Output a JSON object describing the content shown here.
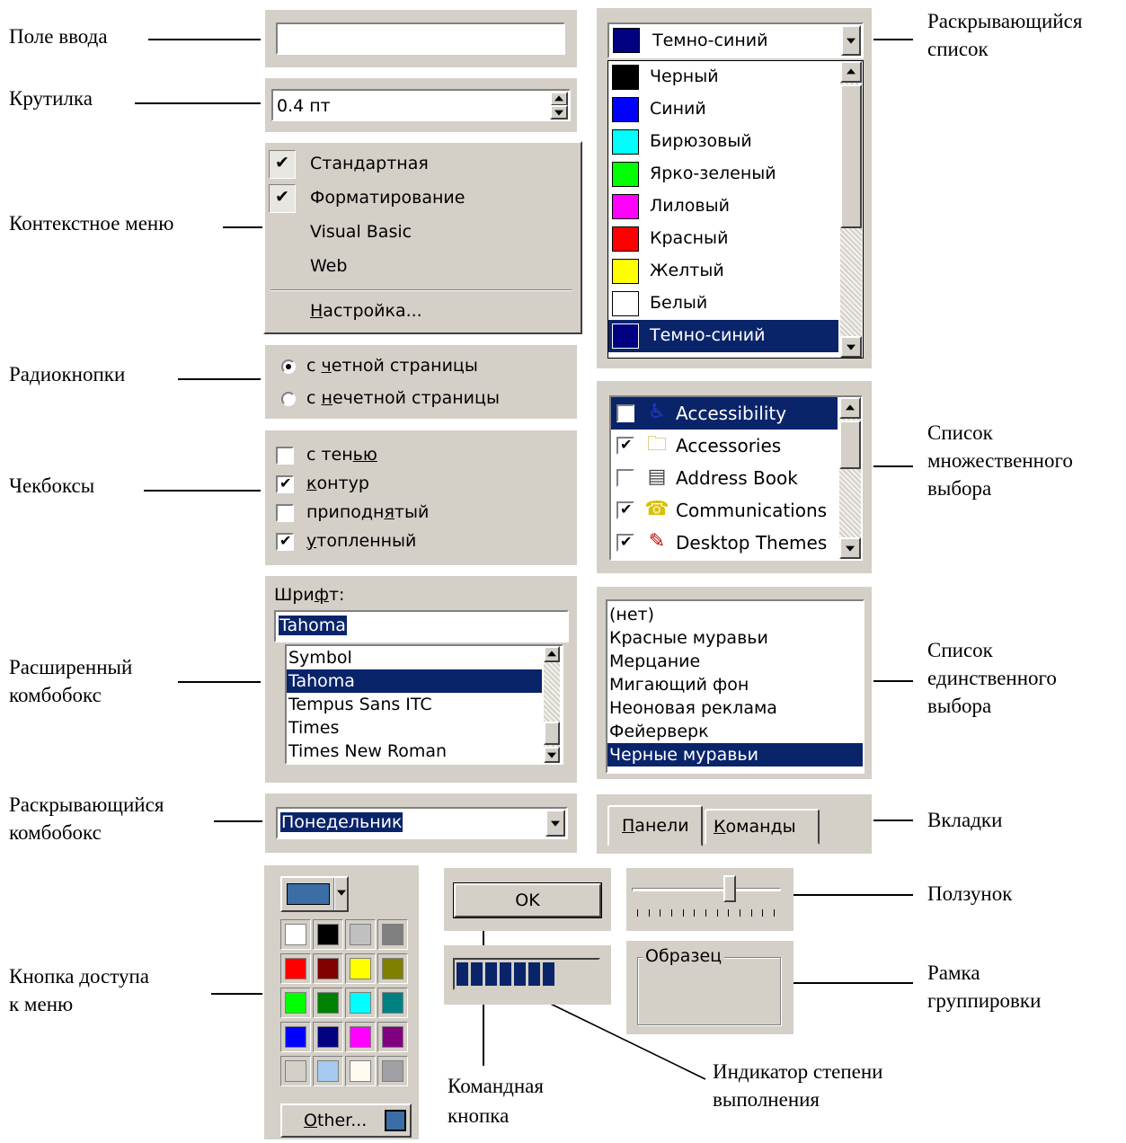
{
  "labels": {
    "input_field": "Поле ввода",
    "spinner": "Крутилка",
    "context_menu": "Контекстное меню",
    "radio_buttons": "Радиокнопки",
    "checkboxes": "Чекбоксы",
    "extended_combobox_1": "Расширенный",
    "extended_combobox_2": "комбобокс",
    "dropdown_combobox_1": "Раскрывающийся",
    "dropdown_combobox_2": "комбобокс",
    "menu_button_1": "Кнопка доступа",
    "menu_button_2": "к меню",
    "dropdown_list_1": "Раскрывающийся",
    "dropdown_list_2": "список",
    "multiselect_1": "Список",
    "multiselect_2": "множественного",
    "multiselect_3": "выбора",
    "singleselect_1": "Список",
    "singleselect_2": "единственного",
    "singleselect_3": "выбора",
    "tabs": "Вкладки",
    "slider": "Ползунок",
    "groupbox_1": "Рамка",
    "groupbox_2": "группировки",
    "command_button_1": "Командная",
    "command_button_2": "кнопка",
    "progress_1": "Индикатор степени",
    "progress_2": "выполнения"
  },
  "text_input": {
    "value": ""
  },
  "spinner": {
    "value": "0.4 пт"
  },
  "context_menu": {
    "items": [
      {
        "label": "Стандартная",
        "checked": true
      },
      {
        "label": "Форматирование",
        "checked": true
      },
      {
        "label": "Visual Basic",
        "checked": false
      },
      {
        "label": "Web",
        "checked": false
      }
    ],
    "customize_label": "Настройка..."
  },
  "radios": {
    "options": [
      {
        "label": "с четной страницы",
        "selected": true
      },
      {
        "label": "с нечетной страницы",
        "selected": false
      }
    ]
  },
  "checkboxes": {
    "items": [
      {
        "label": "с тенью",
        "checked": false
      },
      {
        "label": "контур",
        "checked": true
      },
      {
        "label": "приподнятый",
        "checked": false
      },
      {
        "label": "утопленный",
        "checked": true
      }
    ]
  },
  "font_combo": {
    "label": "Шрифт:",
    "value": "Tahoma",
    "items": [
      "Symbol",
      "Tahoma",
      "Tempus Sans ITC",
      "Times",
      "Times New Roman"
    ],
    "selected": "Tahoma"
  },
  "day_combo": {
    "value": "Понедельник"
  },
  "color_dropdown": {
    "value": "Темно-синий",
    "value_color": "#000080",
    "items": [
      {
        "label": "Черный",
        "color": "#000000"
      },
      {
        "label": "Синий",
        "color": "#0000ff"
      },
      {
        "label": "Бирюзовый",
        "color": "#00ffff"
      },
      {
        "label": "Ярко-зеленый",
        "color": "#00ff00"
      },
      {
        "label": "Лиловый",
        "color": "#ff00ff"
      },
      {
        "label": "Красный",
        "color": "#ff0000"
      },
      {
        "label": "Желтый",
        "color": "#ffff00"
      },
      {
        "label": "Белый",
        "color": "#ffffff"
      },
      {
        "label": "Темно-синий",
        "color": "#000080"
      }
    ],
    "selected": "Темно-синий"
  },
  "multiselect": {
    "items": [
      {
        "label": "Accessibility",
        "checked": false,
        "icon": "wheelchair-icon"
      },
      {
        "label": "Accessories",
        "checked": true,
        "icon": "accessories-folder-icon"
      },
      {
        "label": "Address Book",
        "checked": false,
        "icon": "address-book-icon"
      },
      {
        "label": "Communications",
        "checked": true,
        "icon": "telephone-icon"
      },
      {
        "label": "Desktop Themes",
        "checked": true,
        "icon": "desktop-themes-icon"
      }
    ],
    "selected": "Accessibility"
  },
  "singleselect": {
    "items": [
      "(нет)",
      "Красные муравьи",
      "Мерцание",
      "Мигающий фон",
      "Неоновая реклама",
      "Фейерверк",
      "Черные муравьи"
    ],
    "selected": "Черные муравьи"
  },
  "tabs": {
    "items": [
      "Панели",
      "Команды"
    ],
    "active": "Панели"
  },
  "slider": {
    "value_fraction": 0.67,
    "ticks": 13
  },
  "ok_button": {
    "label": "OK"
  },
  "progress": {
    "segments_filled": 7,
    "fraction": 0.7
  },
  "groupbox": {
    "title": "Образец"
  },
  "color_picker": {
    "current": "#3a6ea5",
    "swatches": [
      "#ffffff",
      "#000000",
      "#c0c0c0",
      "#808080",
      "#ff0000",
      "#800000",
      "#ffff00",
      "#808000",
      "#00ff00",
      "#008000",
      "#00ffff",
      "#008080",
      "#0000ff",
      "#000080",
      "#ff00ff",
      "#800080",
      "#d4d0c8",
      "#a6caf0",
      "#fffbf0",
      "#a0a0a4"
    ],
    "other_label": "Other..."
  }
}
